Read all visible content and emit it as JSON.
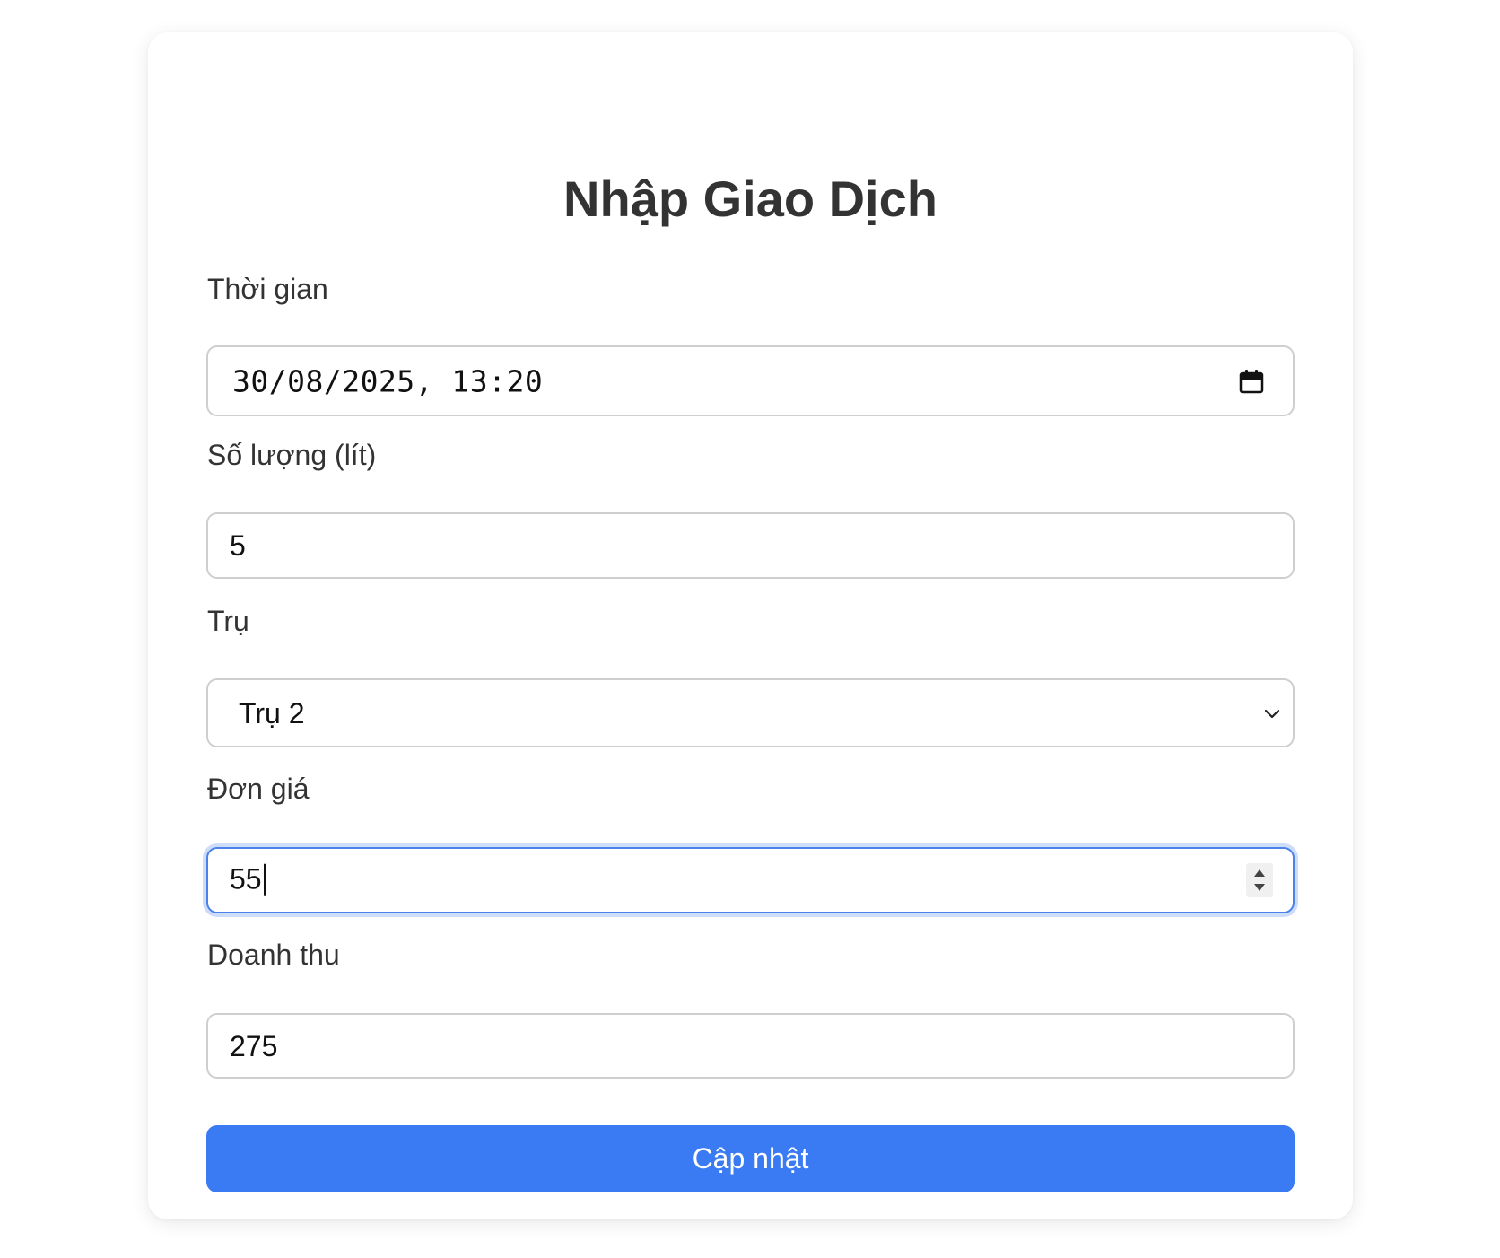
{
  "form": {
    "title": "Nhập Giao Dịch",
    "fields": {
      "time": {
        "label": "Thời gian",
        "value": "30/08/2025, 13:20",
        "icon": "calendar-icon"
      },
      "quantity": {
        "label": "Số lượng (lít)",
        "value": "5"
      },
      "pump": {
        "label": "Trụ",
        "selected": "Trụ 2",
        "icon": "chevron-down-icon"
      },
      "unit_price": {
        "label": "Đơn giá",
        "value": "55",
        "focused": true
      },
      "revenue": {
        "label": "Doanh thu",
        "value": "275"
      }
    },
    "submit_label": "Cập nhật"
  },
  "colors": {
    "accent": "#3a7bf3",
    "focus_ring": "#4a82ea",
    "border": "#cfcfcf",
    "text": "#333333"
  }
}
